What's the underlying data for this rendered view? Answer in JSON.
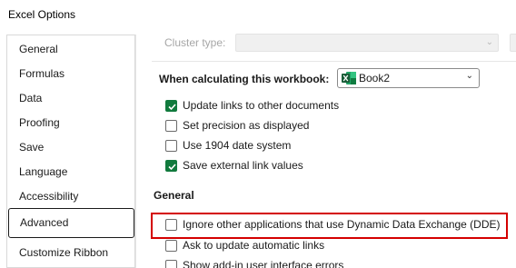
{
  "window": {
    "title": "Excel Options"
  },
  "sidebar": {
    "items": [
      {
        "label": "General",
        "active": false
      },
      {
        "label": "Formulas",
        "active": false
      },
      {
        "label": "Data",
        "active": false
      },
      {
        "label": "Proofing",
        "active": false
      },
      {
        "label": "Save",
        "active": false
      },
      {
        "label": "Language",
        "active": false
      },
      {
        "label": "Accessibility",
        "active": false
      },
      {
        "label": "Advanced",
        "active": true
      },
      {
        "label": "Customize Ribbon",
        "active": false
      }
    ]
  },
  "main": {
    "cluster_type": {
      "label": "Cluster type:",
      "value": "",
      "disabled": true
    },
    "workbook": {
      "label": "When calculating this workbook:",
      "selected": "Book2",
      "icon": "excel-workbook-icon"
    },
    "calc_options": [
      {
        "label": "Update links to other documents",
        "checked": true
      },
      {
        "label": "Set precision as displayed",
        "checked": false
      },
      {
        "label": "Use 1904 date system",
        "checked": false
      },
      {
        "label": "Save external link values",
        "checked": true
      }
    ],
    "general_heading": "General",
    "general_options": [
      {
        "label": "Ignore other applications that use Dynamic Data Exchange (DDE)",
        "checked": false,
        "highlighted": true
      },
      {
        "label": "Ask to update automatic links",
        "checked": false
      },
      {
        "label": "Show add-in user interface errors",
        "checked": false
      }
    ]
  },
  "colors": {
    "accent_green": "#117a3d",
    "highlight_red": "#d40000"
  }
}
